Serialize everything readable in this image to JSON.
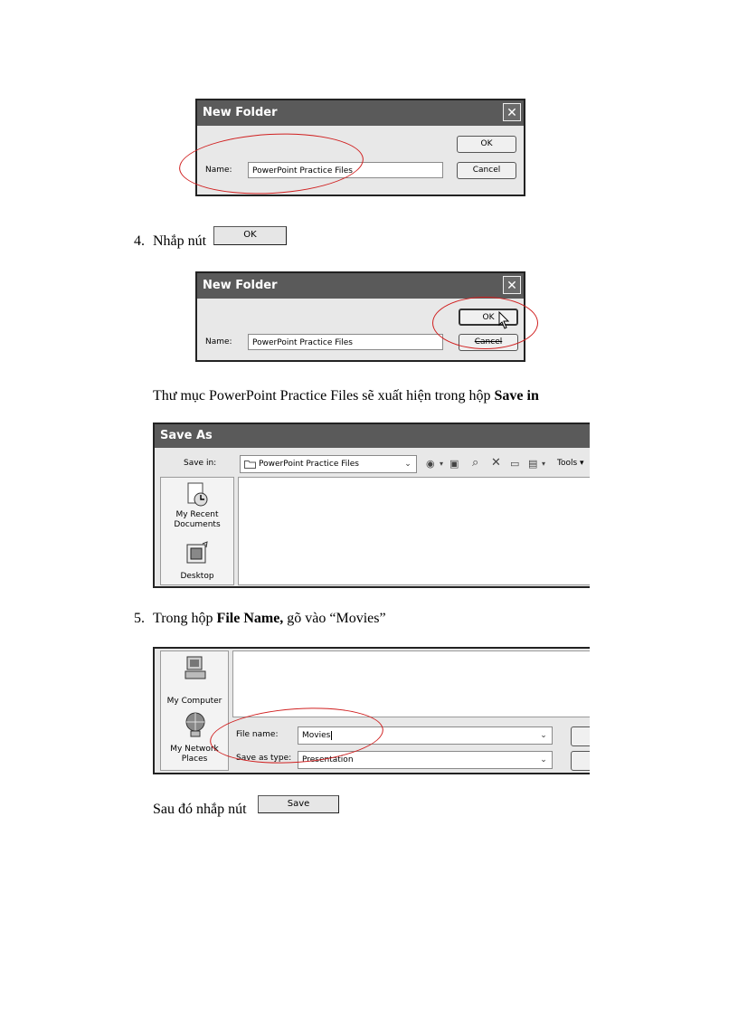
{
  "dialog1": {
    "title": "New Folder",
    "close_glyph": "✕",
    "name_label": "Name:",
    "name_value": "PowerPoint Practice Files",
    "ok_label": "OK",
    "cancel_label": "Cancel"
  },
  "step4": {
    "number": "4.",
    "text": "Nhắp nút",
    "button_label": "OK"
  },
  "dialog2": {
    "title": "New Folder",
    "close_glyph": "✕",
    "name_label": "Name:",
    "name_value": "PowerPoint Practice Files",
    "ok_label": "OK",
    "cancel_label": "Cancel"
  },
  "note1": {
    "text": "Thư mục PowerPoint Practice Files sẽ xuất hiện trong hộp ",
    "bold": "Save in"
  },
  "saveas": {
    "title": "Save As",
    "save_in_label": "Save in:",
    "save_in_value": "PowerPoint Practice Files",
    "tools_label": "Tools",
    "places": [
      {
        "label_line1": "My Recent",
        "label_line2": "Documents",
        "icon": "recent-documents-icon"
      },
      {
        "label_line1": "Desktop",
        "label_line2": "",
        "icon": "desktop-icon"
      }
    ]
  },
  "step5": {
    "number": "5.",
    "text_before": "Trong hộp ",
    "bold": "File Name,",
    "text_after": " gõ vào “Movies”"
  },
  "filename_panel": {
    "places": [
      {
        "label_line1": "My Computer",
        "label_line2": "",
        "icon": "my-computer-icon"
      },
      {
        "label_line1": "My Network",
        "label_line2": "Places",
        "icon": "my-network-places-icon"
      }
    ],
    "file_name_label": "File name:",
    "file_name_value": "Movies",
    "save_as_type_label": "Save as type:",
    "save_as_type_value": "Presentation"
  },
  "final": {
    "text": "Sau đó nhắp nút",
    "button_label": "Save"
  }
}
